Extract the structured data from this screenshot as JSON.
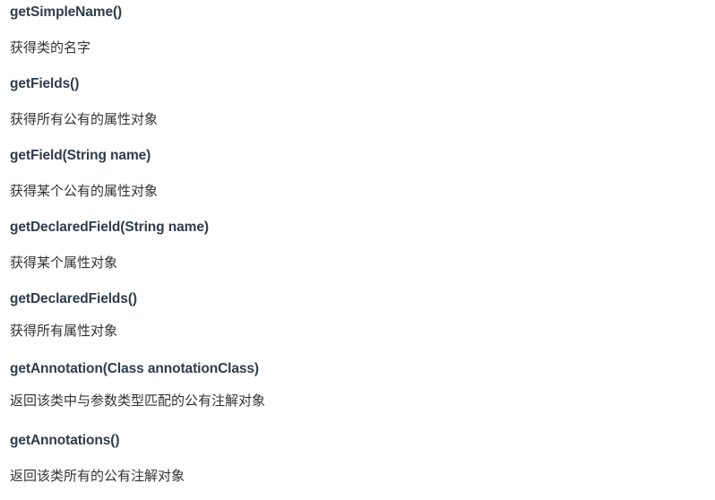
{
  "entries": [
    {
      "method": "getSimpleName()",
      "desc": "获得类的名字"
    },
    {
      "method": "getFields()",
      "desc": "获得所有公有的属性对象"
    },
    {
      "method": "getField(String name)",
      "desc": "获得某个公有的属性对象"
    },
    {
      "method": "getDeclaredField(String name)",
      "desc": "获得某个属性对象"
    },
    {
      "method": "getDeclaredFields()",
      "desc": "获得所有属性对象"
    },
    {
      "method": "getAnnotation(Class annotationClass)",
      "desc": "返回该类中与参数类型匹配的公有注解对象"
    },
    {
      "method": "getAnnotations()",
      "desc": "返回该类所有的公有注解对象"
    }
  ]
}
